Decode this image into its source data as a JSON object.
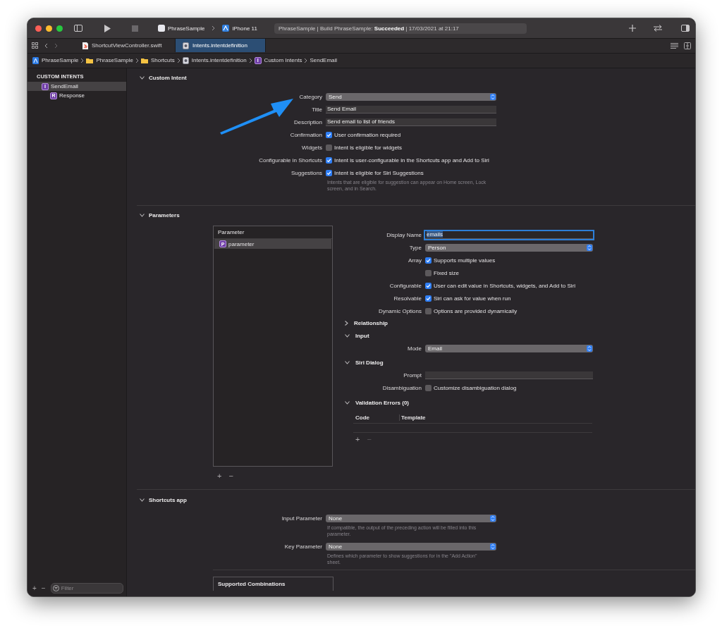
{
  "toolbar": {
    "scheme": "PhraseSample",
    "device": "iPhone 11",
    "status": "PhraseSample | Build PhraseSample: **Succeeded** | 17/03/2021 at 21:17"
  },
  "tabs": [
    {
      "label": "ShortcutViewController.swift",
      "kind": "swift",
      "selected": false
    },
    {
      "label": "Intents.intentdefinition",
      "kind": "intents",
      "selected": true
    }
  ],
  "breadcrumbs": [
    {
      "label": "PhraseSample",
      "kind": "project"
    },
    {
      "label": "PhraseSample",
      "kind": "folder"
    },
    {
      "label": "Shortcuts",
      "kind": "folder"
    },
    {
      "label": "Intents.intentdefinition",
      "kind": "intents"
    },
    {
      "label": "Custom Intents",
      "kind": "badge",
      "badge": "I"
    },
    {
      "label": "SendEmail",
      "kind": "plain"
    }
  ],
  "sidebar": {
    "heading": "CUSTOM INTENTS",
    "items": [
      {
        "badge": "I",
        "label": "SendEmail",
        "selected": true,
        "children": [
          {
            "badge": "R",
            "label": "Response",
            "selected": false
          }
        ]
      }
    ],
    "buttons": [
      {
        "label": "+",
        "disabled": false
      },
      {
        "label": "−",
        "disabled": false
      }
    ],
    "filter": {
      "placeholder": "Filter"
    }
  },
  "custom_intent": {
    "title": "Custom Intent",
    "expanded": true,
    "rows": [
      {
        "kind": "popup",
        "label": "Category",
        "value": "Send"
      },
      {
        "kind": "text",
        "label": "Title",
        "value": "Send Email",
        "focused": false
      },
      {
        "kind": "text",
        "label": "Description",
        "value": "Send email to list of friends",
        "focused": false
      },
      {
        "kind": "checkbox",
        "label": "Confirmation",
        "text": "User confirmation required",
        "checked": true
      },
      {
        "kind": "checkbox",
        "label": "Widgets",
        "text": "Intent is eligible for widgets",
        "checked": false
      },
      {
        "kind": "checkbox",
        "label": "Configurable in Shortcuts",
        "text": "Intent is user-configurable in the Shortcuts app and Add to Siri",
        "checked": true
      },
      {
        "kind": "checkbox",
        "label": "Suggestions",
        "text": "Intent is eligible for Siri Suggestions",
        "checked": true,
        "hint": "Intents that are eligible for suggestion can appear on Home screen, Lock screen, and in Search."
      }
    ]
  },
  "parameters": {
    "title": "Parameters",
    "expanded": true,
    "list": {
      "heading": "Parameter",
      "items": [
        {
          "badge": "P",
          "label": "parameter",
          "selected": true
        }
      ],
      "buttons": [
        {
          "label": "+",
          "disabled": false
        },
        {
          "label": "−",
          "disabled": false
        }
      ]
    },
    "rows": [
      {
        "kind": "text",
        "label": "Display Name",
        "value": "emails",
        "focused": true
      },
      {
        "kind": "popup",
        "label": "Type",
        "value": "Person"
      },
      {
        "kind": "checkbox",
        "label": "Array",
        "text": "Supports multiple values",
        "checked": true
      },
      {
        "kind": "checkbox",
        "text": "Fixed size",
        "checked": false
      },
      {
        "kind": "checkbox",
        "label": "Configurable",
        "text": "User can edit value in Shortcuts, widgets, and Add to Siri",
        "checked": true
      },
      {
        "kind": "checkbox",
        "label": "Resolvable",
        "text": "Siri can ask for value when run",
        "checked": true
      },
      {
        "kind": "checkbox",
        "label": "Dynamic Options",
        "text": "Options are provided dynamically",
        "checked": false
      }
    ],
    "subsections": [
      {
        "title": "Relationship",
        "expanded": false
      },
      {
        "title": "Input",
        "expanded": true,
        "rows": [
          {
            "kind": "popup",
            "label": "Mode",
            "value": "Email"
          }
        ]
      },
      {
        "title": "Siri Dialog",
        "expanded": true,
        "rows": [
          {
            "kind": "text",
            "label": "Prompt",
            "focused": false
          },
          {
            "kind": "checkbox",
            "label": "Disambiguation",
            "text": "Customize disambiguation dialog",
            "checked": false
          }
        ]
      },
      {
        "title": "Validation Errors (0)",
        "expanded": true,
        "table": {
          "columns": [
            "Code",
            "Template"
          ]
        },
        "buttons": [
          {
            "label": "+",
            "disabled": false
          },
          {
            "label": "−",
            "disabled": true
          }
        ]
      }
    ]
  },
  "shortcuts_app": {
    "title": "Shortcuts app",
    "expanded": true,
    "rows": [
      {
        "kind": "popup",
        "label": "Input Parameter",
        "value": "None",
        "hint": "If compatible, the output of the preceding action will be filled into this parameter."
      },
      {
        "kind": "popup",
        "label": "Key Parameter",
        "value": "None",
        "hint": "Defines which parameter to show suggestions for in the \"Add Action\" sheet."
      }
    ],
    "combinations": {
      "heading": "Supported Combinations"
    }
  },
  "annotation": {
    "kind": "arrow"
  }
}
